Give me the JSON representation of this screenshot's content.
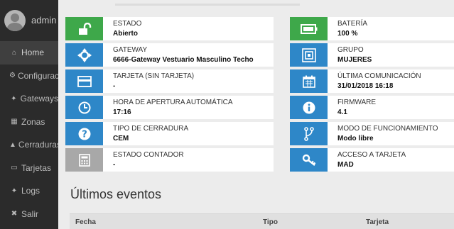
{
  "user": {
    "name": "admin"
  },
  "nav": [
    {
      "label": "Home",
      "icon": "home-icon",
      "glyph": "⌂",
      "active": true
    },
    {
      "label": "Configuración",
      "icon": "gear-icon",
      "glyph": "⚙"
    },
    {
      "label": "Gateways",
      "icon": "arrows-icon",
      "glyph": "✦"
    },
    {
      "label": "Zonas",
      "icon": "building-icon",
      "glyph": "▦"
    },
    {
      "label": "Cerraduras",
      "icon": "lock-icon",
      "glyph": "▲"
    },
    {
      "label": "Tarjetas",
      "icon": "card-icon",
      "glyph": "▭"
    },
    {
      "label": "Logs",
      "icon": "arrows-icon",
      "glyph": "✦"
    },
    {
      "label": "Salir",
      "icon": "close-icon",
      "glyph": "✖"
    }
  ],
  "cards_left": [
    {
      "label": "ESTADO",
      "value": "Abierto",
      "icon": "unlock-icon",
      "color": "#3ea84a"
    },
    {
      "label": "GATEWAY",
      "value": "6666-Gateway Vestuario Masculino Techo",
      "icon": "crosshair-icon",
      "color": "#2e87c8"
    },
    {
      "label": "TARJETA (SIN TARJETA)",
      "value": "-",
      "icon": "card-icon",
      "color": "#2e87c8"
    },
    {
      "label": "HORA DE APERTURA AUTOMÁTICA",
      "value": "17:16",
      "icon": "clock-icon",
      "color": "#2e87c8"
    },
    {
      "label": "TIPO DE CERRADURA",
      "value": "CEM",
      "icon": "question-icon",
      "color": "#2e87c8"
    },
    {
      "label": "ESTADO CONTADOR",
      "value": "-",
      "icon": "calculator-icon",
      "color": "#a8a8a8"
    }
  ],
  "cards_right": [
    {
      "label": "BATERÍA",
      "value": "100 %",
      "icon": "battery-icon",
      "color": "#3ea84a"
    },
    {
      "label": "GRUPO",
      "value": "MUJERES",
      "icon": "group-icon",
      "color": "#2e87c8"
    },
    {
      "label": "ÚLTIMA COMUNICACIÓN",
      "value": "31/01/2018 16:18",
      "icon": "calendar-icon",
      "color": "#2e87c8"
    },
    {
      "label": "FIRMWARE",
      "value": "4.1",
      "icon": "info-icon",
      "color": "#2e87c8"
    },
    {
      "label": "MODO DE FUNCIONAMIENTO",
      "value": "Modo libre",
      "icon": "fork-icon",
      "color": "#2e87c8"
    },
    {
      "label": "ACCESO A TARJETA",
      "value": "MAD",
      "icon": "key-icon",
      "color": "#2e87c8"
    }
  ],
  "events": {
    "title": "Últimos eventos",
    "columns": [
      "Fecha",
      "Tipo",
      "Tarjeta"
    ]
  }
}
